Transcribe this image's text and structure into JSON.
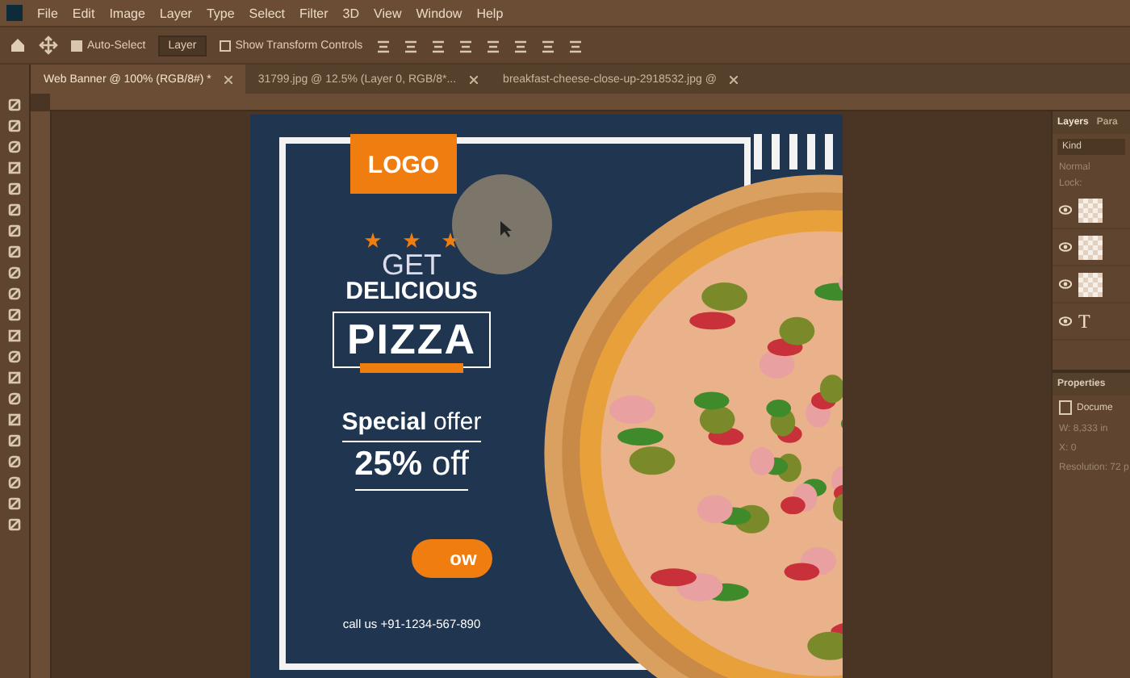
{
  "menu_bar": {
    "items": [
      "File",
      "Edit",
      "Image",
      "Layer",
      "Type",
      "Select",
      "Filter",
      "3D",
      "View",
      "Window",
      "Help"
    ]
  },
  "options_bar": {
    "auto_select": {
      "label": "Auto-Select",
      "checked": true
    },
    "target": "Layer",
    "transform_controls": {
      "label": "Show Transform Controls",
      "checked": false
    }
  },
  "tabs": [
    {
      "label": "Web Banner @ 100% (RGB/8#) *",
      "selected": true
    },
    {
      "label": "31799.jpg @ 12.5% (Layer 0, RGB/8*...",
      "selected": false
    },
    {
      "label": "breakfast-cheese-close-up-2918532.jpg @",
      "selected": false
    }
  ],
  "banner": {
    "logo": "LOGO",
    "stars": 3,
    "get": "GET",
    "delicious": "DELICIOUS",
    "pizza": "PIZZA",
    "offer": "**Special** offer",
    "discount": "**25%** off",
    "button": "ow",
    "phone": "call us +91-1234-567-890"
  },
  "layers_panel": {
    "tabs": [
      {
        "label": "Layers",
        "selected": true
      },
      {
        "label": "Para",
        "selected": false
      }
    ],
    "search": "Kind",
    "blend_mode": "Normal",
    "lock_label": "Lock:",
    "layers": [
      {
        "kind": "pixel",
        "visible": true
      },
      {
        "kind": "pixel",
        "visible": true
      },
      {
        "kind": "pixel",
        "visible": true
      },
      {
        "kind": "text",
        "visible": true,
        "glyph": "T"
      }
    ]
  },
  "properties_panel": {
    "title": "Properties",
    "document": "Docume",
    "width": "W: 8,333 in",
    "x": "X: 0",
    "resolution": "Resolution: 72 p"
  }
}
